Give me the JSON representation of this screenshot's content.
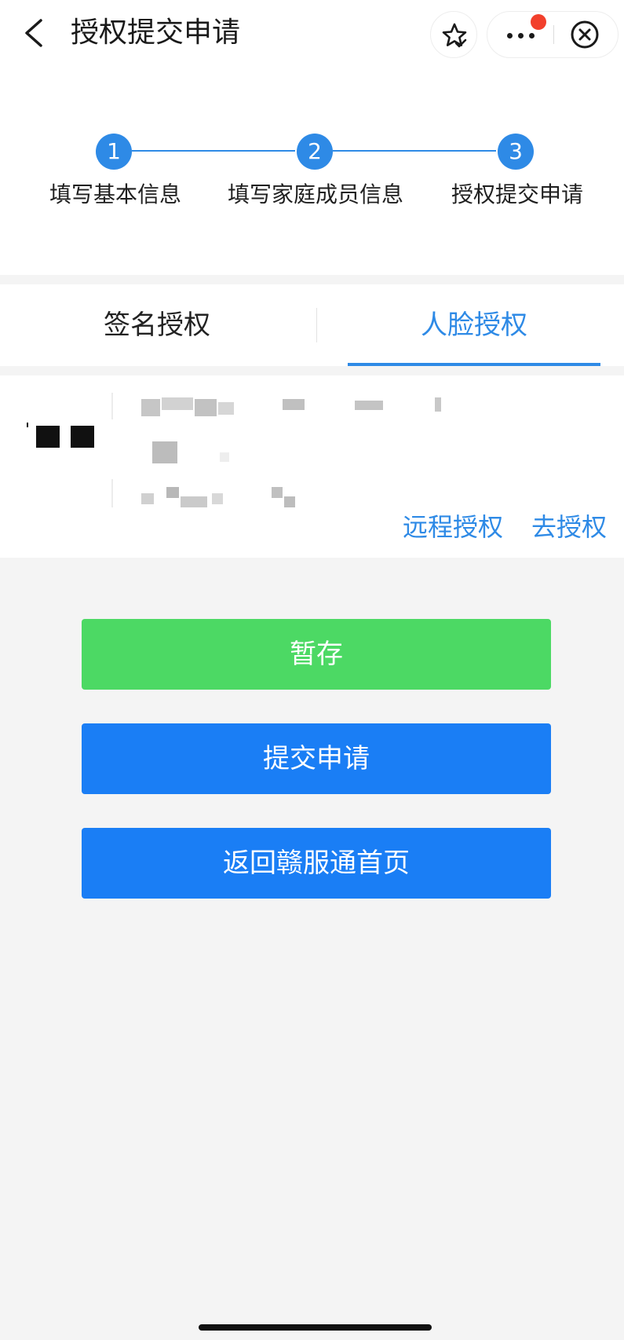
{
  "header": {
    "title": "授权提交申请",
    "icons": {
      "back": "chevron-left-icon",
      "favorite": "star-check-icon",
      "more": "more-dots-icon",
      "close": "close-circle-icon"
    }
  },
  "steps": [
    {
      "number": "1",
      "label": "填写基本信息"
    },
    {
      "number": "2",
      "label": "填写家庭成员信息"
    },
    {
      "number": "3",
      "label": "授权提交申请"
    }
  ],
  "tabs": [
    {
      "label": "签名授权",
      "active": false
    },
    {
      "label": "人脸授权",
      "active": true
    }
  ],
  "member": {
    "actions": {
      "remote": "远程授权",
      "authorize": "去授权"
    }
  },
  "buttons": {
    "save": "暂存",
    "submit": "提交申请",
    "home": "返回赣服通首页"
  },
  "colors": {
    "accent": "#2e8ae6",
    "save_button": "#4cd964",
    "primary_button": "#1a7ef5",
    "badge": "#f2402c",
    "background": "#f4f4f4"
  }
}
